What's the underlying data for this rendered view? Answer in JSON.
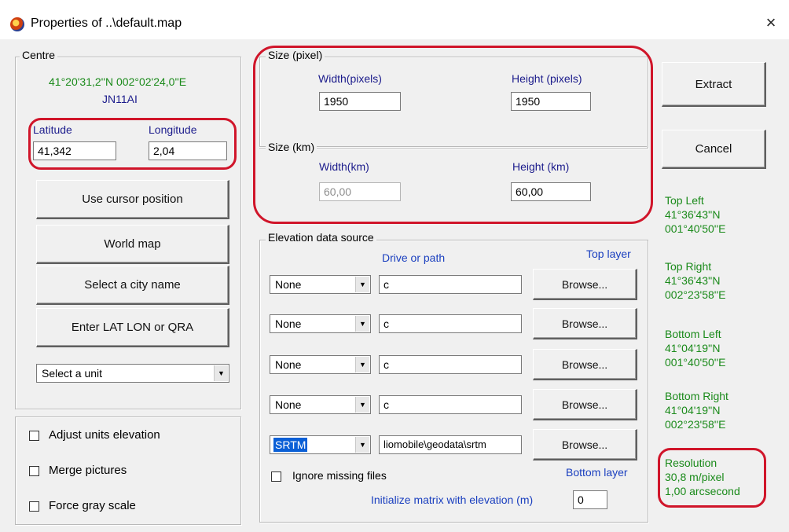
{
  "window": {
    "title": "Properties of ..\\default.map",
    "close_glyph": "×",
    "app_icon": "globe-icon"
  },
  "centre": {
    "legend": "Centre",
    "coords": "41°20'31,2''N 002°02'24,0''E",
    "locator": "JN11AI",
    "latitude_label": "Latitude",
    "longitude_label": "Longitude",
    "latitude_value": "41,342",
    "longitude_value": "2,04"
  },
  "actions": {
    "use_cursor": "Use cursor position",
    "world_map": "World map",
    "select_city": "Select a city name",
    "enter_latlon": "Enter LAT LON or QRA",
    "unit_select": "Select a unit"
  },
  "options": {
    "adjust_units_elevation": "Adjust units elevation",
    "merge_pictures": "Merge pictures",
    "force_gray_scale": "Force gray scale"
  },
  "size_pixel": {
    "legend": "Size (pixel)",
    "width_label": "Width(pixels)",
    "height_label": "Height (pixels)",
    "width_value": "1950",
    "height_value": "1950"
  },
  "size_km": {
    "legend": "Size (km)",
    "width_label": "Width(km)",
    "height_label": "Height (km)",
    "width_value": "60,00",
    "height_value": "60,00"
  },
  "elevation": {
    "legend": "Elevation data source",
    "drive_label": "Drive or path",
    "top_layer": "Top layer",
    "bottom_layer": "Bottom layer",
    "rows": [
      {
        "source": "None",
        "path": "c",
        "browse": "Browse..."
      },
      {
        "source": "None",
        "path": "c",
        "browse": "Browse..."
      },
      {
        "source": "None",
        "path": "c",
        "browse": "Browse..."
      },
      {
        "source": "None",
        "path": "c",
        "browse": "Browse..."
      },
      {
        "source": "SRTM",
        "path": "liomobile\\geodata\\srtm",
        "browse": "Browse..."
      }
    ],
    "ignore_missing": "Ignore missing files",
    "init_matrix_label": "Initialize matrix with elevation (m)",
    "init_matrix_value": "0"
  },
  "buttons": {
    "extract": "Extract",
    "cancel": "Cancel"
  },
  "corners": {
    "top_left": {
      "label": "Top Left",
      "lat": "41°36'43''N",
      "lon": "001°40'50''E"
    },
    "top_right": {
      "label": "Top Right",
      "lat": "41°36'43''N",
      "lon": "002°23'58''E"
    },
    "bottom_left": {
      "label": "Bottom Left",
      "lat": "41°04'19''N",
      "lon": "001°40'50''E"
    },
    "bottom_right": {
      "label": "Bottom Right",
      "lat": "41°04'19''N",
      "lon": "002°23'58''E"
    }
  },
  "resolution": {
    "label": "Resolution",
    "per_pixel": "30,8 m/pixel",
    "arcsec": "1,00 arcsecond"
  },
  "colors": {
    "highlight_ring": "#d0152a",
    "info_text": "#1a8a1a",
    "label_text": "#1c1c8c",
    "selection": "#0a5fd6"
  }
}
